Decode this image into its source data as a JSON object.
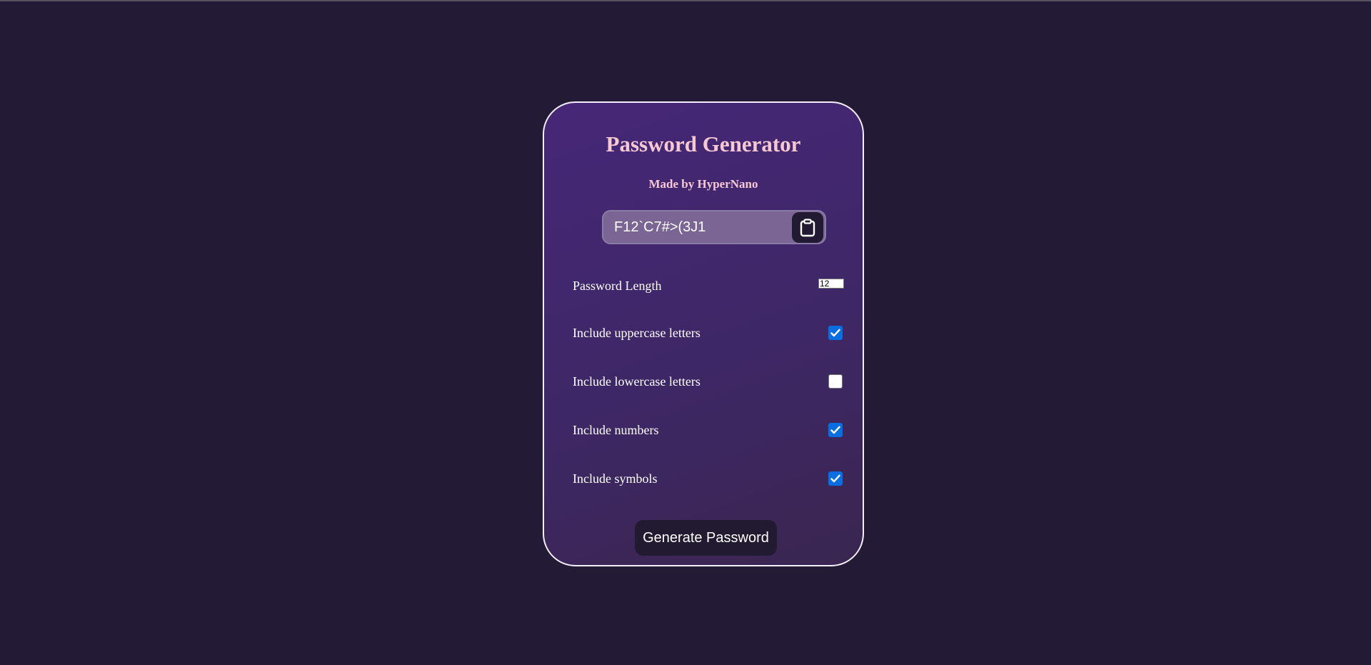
{
  "app": {
    "title": "Password Generator",
    "subtitle": "Made by HyperNano"
  },
  "password": {
    "value": "F12`C7#>(3J1",
    "copy_icon": "clipboard-icon"
  },
  "options": {
    "length_label": "Password Length",
    "length_value": "12",
    "uppercase_label": "Include uppercase letters",
    "uppercase_checked": true,
    "lowercase_label": "Include lowercase letters",
    "lowercase_checked": false,
    "numbers_label": "Include numbers",
    "numbers_checked": true,
    "symbols_label": "Include symbols",
    "symbols_checked": true
  },
  "actions": {
    "generate_label": "Generate Password"
  },
  "colors": {
    "background": "#231a36",
    "title": "#f6c8d4",
    "checkbox_accent": "#0b6ee0",
    "button": "#221a30"
  }
}
